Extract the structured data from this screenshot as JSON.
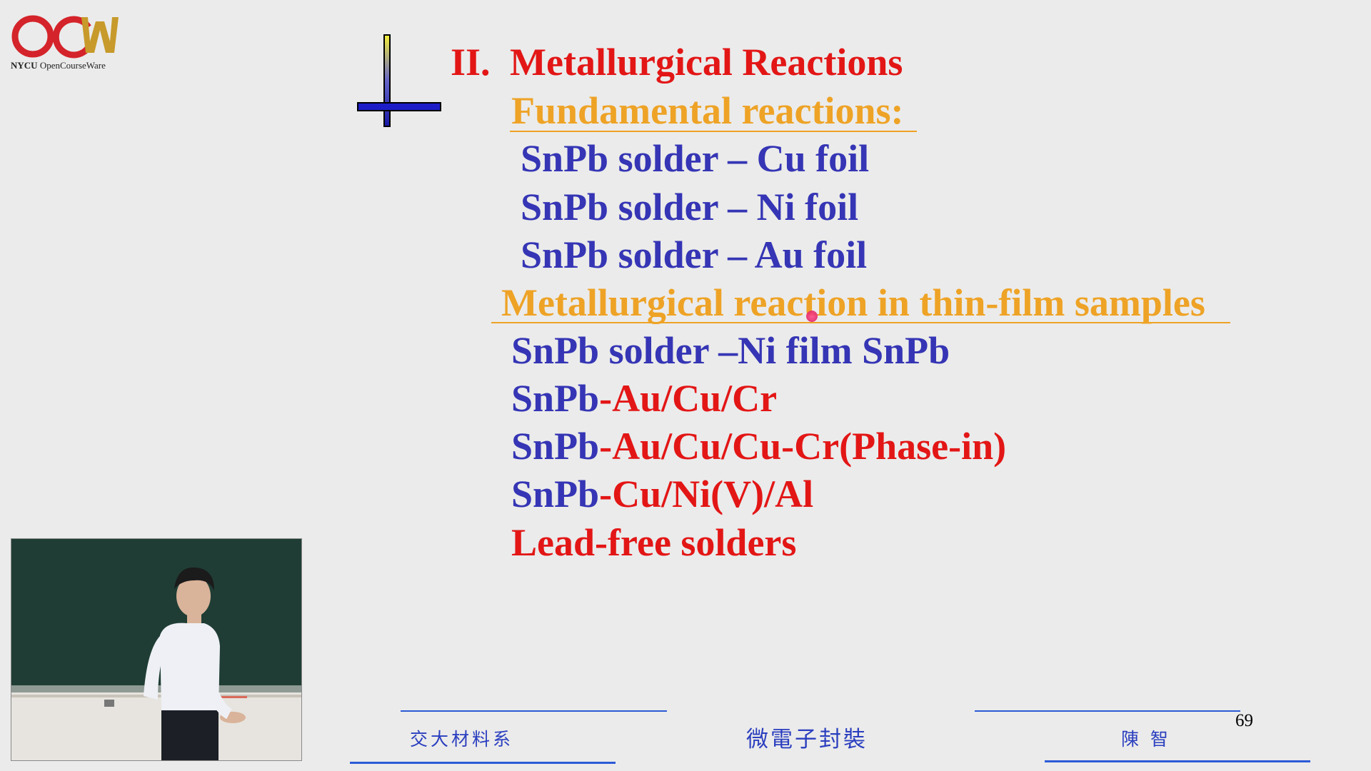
{
  "logo": {
    "mark": "OCW",
    "org": "NYCU",
    "caption": "OpenCourseWare",
    "colors": {
      "red": "#d4232a",
      "gold": "#c79a2b"
    }
  },
  "slide": {
    "heading": {
      "number": "II.",
      "title": "Metallurgical Reactions"
    },
    "sections": [
      {
        "label": "Fundamental reactions:",
        "items": [
          "SnPb solder – Cu foil",
          "SnPb solder – Ni foil",
          "SnPb solder – Au foil"
        ]
      },
      {
        "label": "Metallurgical reaction in thin-film samples",
        "items": [
          {
            "a": "SnPb solder –Ni film SnPb",
            "b": ""
          },
          {
            "a": "SnPb",
            "b": "-Au/Cu/Cr"
          },
          {
            "a": "SnPb",
            "b": "-Au/Cu/Cu-Cr(Phase-in)"
          },
          {
            "a": "SnPb",
            "b": "-Cu/Ni(V)/Al"
          },
          {
            "a": "",
            "b": "Lead-free solders"
          }
        ]
      }
    ],
    "colors": {
      "heading": "#e31616",
      "section": "#eea326",
      "item": "#3535b5"
    }
  },
  "footer": {
    "left": "交大材料系",
    "center": "微電子封裝",
    "right": "陳  智",
    "page": "69"
  },
  "video": {
    "description_icon": "lecturer-video-inset"
  }
}
